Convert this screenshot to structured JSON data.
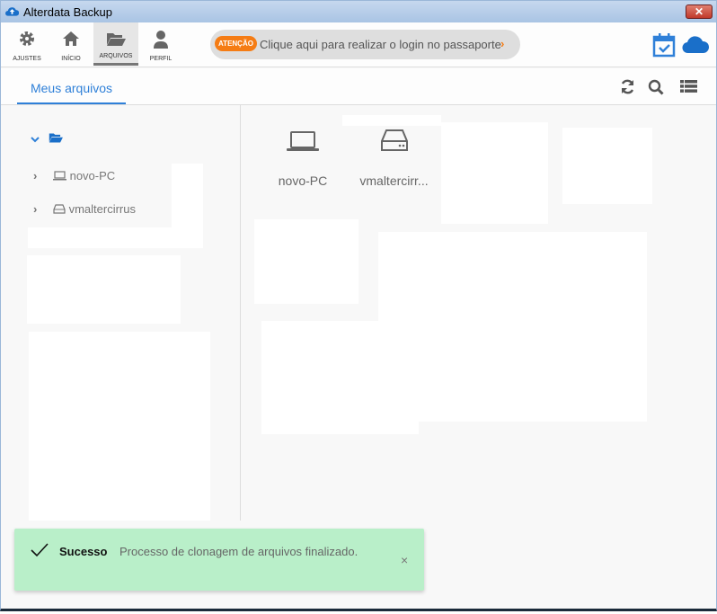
{
  "window": {
    "title": "Alterdata Backup",
    "close": "✕"
  },
  "toolbar": {
    "items": [
      {
        "label": "AJUSTES"
      },
      {
        "label": "INÍCIO"
      },
      {
        "label": "ARQUIVOS"
      },
      {
        "label": "PERFIL"
      }
    ],
    "notice": {
      "badge": "ATENÇÃO",
      "text": "Clique aqui para realizar o login no passaporte",
      "chevron": "›"
    }
  },
  "tabs": {
    "active": "Meus arquivos"
  },
  "tree": {
    "items": [
      {
        "label": "novo-PC"
      },
      {
        "label": "vmaltercirrus"
      }
    ]
  },
  "files": [
    {
      "label": "novo-PC"
    },
    {
      "label": "vmaltercirr..."
    }
  ],
  "toast": {
    "title": "Sucesso",
    "message": "Processo de clonagem de arquivos finalizado.",
    "close": "×"
  },
  "colors": {
    "accent": "#2f80d8",
    "warning": "#f57c14",
    "success_bg": "#b9efc9"
  }
}
